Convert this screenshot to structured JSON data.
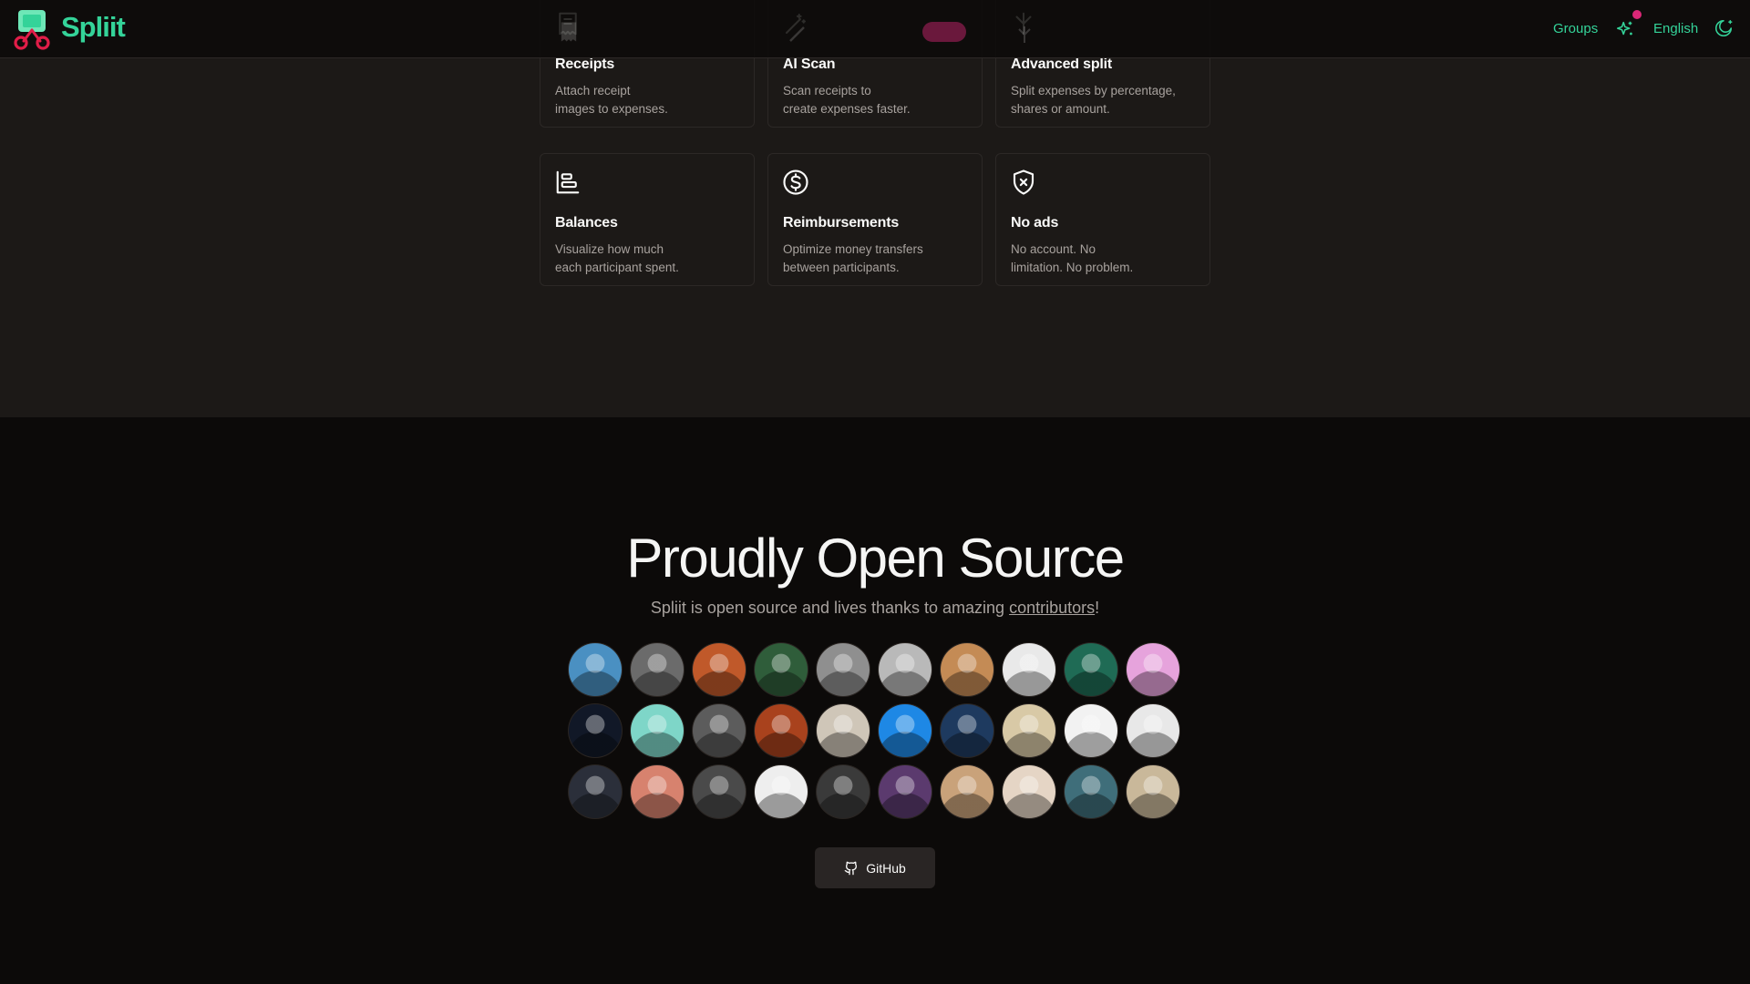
{
  "header": {
    "brand": "Spliit",
    "nav": {
      "groups": "Groups",
      "language": "English"
    },
    "colors": {
      "accent": "#34d399",
      "notification": "#db2777"
    }
  },
  "features": [
    {
      "icon": "receipt-icon",
      "title": "Receipts",
      "desc_line1": "Attach receipt",
      "desc_line2": "images to expenses."
    },
    {
      "icon": "wand-icon",
      "title": "AI Scan",
      "desc_line1": "Scan receipts to",
      "desc_line2": "create expenses faster."
    },
    {
      "icon": "split-icon",
      "title": "Advanced split",
      "desc_line1": "Split expenses by percentage,",
      "desc_line2": "shares or amount."
    },
    {
      "icon": "balance-chart-icon",
      "title": "Balances",
      "desc_line1": "Visualize how much",
      "desc_line2": "each participant spent."
    },
    {
      "icon": "dollar-circle-icon",
      "title": "Reimbursements",
      "desc_line1": "Optimize money transfers",
      "desc_line2": "between participants."
    },
    {
      "icon": "shield-x-icon",
      "title": "No ads",
      "desc_line1": "No account. No",
      "desc_line2": "limitation. No problem."
    }
  ],
  "open_source": {
    "title": "Proudly Open Source",
    "subtitle_before": "Spliit is open source and lives thanks to amazing ",
    "subtitle_link": "contributors",
    "subtitle_after": "!",
    "github_label": "GitHub"
  },
  "contributors": [
    {
      "name": "contributor-1",
      "color": "#4a90c2"
    },
    {
      "name": "contributor-2",
      "color": "#6b6b6b"
    },
    {
      "name": "contributor-3",
      "color": "#c0592a"
    },
    {
      "name": "contributor-4",
      "color": "#2f5d3a"
    },
    {
      "name": "contributor-5",
      "color": "#8f8f8f"
    },
    {
      "name": "contributor-6",
      "color": "#b9b9b9"
    },
    {
      "name": "contributor-7",
      "color": "#c48b55"
    },
    {
      "name": "contributor-8",
      "color": "#e9e9e9"
    },
    {
      "name": "contributor-9",
      "color": "#1f6b55"
    },
    {
      "name": "contributor-10",
      "color": "#e6a3dc"
    },
    {
      "name": "contributor-11",
      "color": "#111827"
    },
    {
      "name": "contributor-12",
      "color": "#7ed6c8"
    },
    {
      "name": "contributor-13",
      "color": "#5c5c5c"
    },
    {
      "name": "contributor-14",
      "color": "#a9421d"
    },
    {
      "name": "contributor-15",
      "color": "#cfc6b8"
    },
    {
      "name": "contributor-16",
      "color": "#1e88e5"
    },
    {
      "name": "contributor-17",
      "color": "#1e3a5f"
    },
    {
      "name": "contributor-18",
      "color": "#d8c9a6"
    },
    {
      "name": "contributor-19",
      "color": "#f2f2f2"
    },
    {
      "name": "contributor-20",
      "color": "#e8e8e8"
    },
    {
      "name": "contributor-21",
      "color": "#2b2f3a"
    },
    {
      "name": "contributor-22",
      "color": "#d7826e"
    },
    {
      "name": "contributor-23",
      "color": "#4a4a4a"
    },
    {
      "name": "contributor-24",
      "color": "#eeeeee"
    },
    {
      "name": "contributor-25",
      "color": "#3a3a3a"
    },
    {
      "name": "contributor-26",
      "color": "#5b3a6e"
    },
    {
      "name": "contributor-27",
      "color": "#c9a27a"
    },
    {
      "name": "contributor-28",
      "color": "#e5d5c5"
    },
    {
      "name": "contributor-29",
      "color": "#3f6e7a"
    },
    {
      "name": "contributor-30",
      "color": "#c9b89a"
    }
  ]
}
